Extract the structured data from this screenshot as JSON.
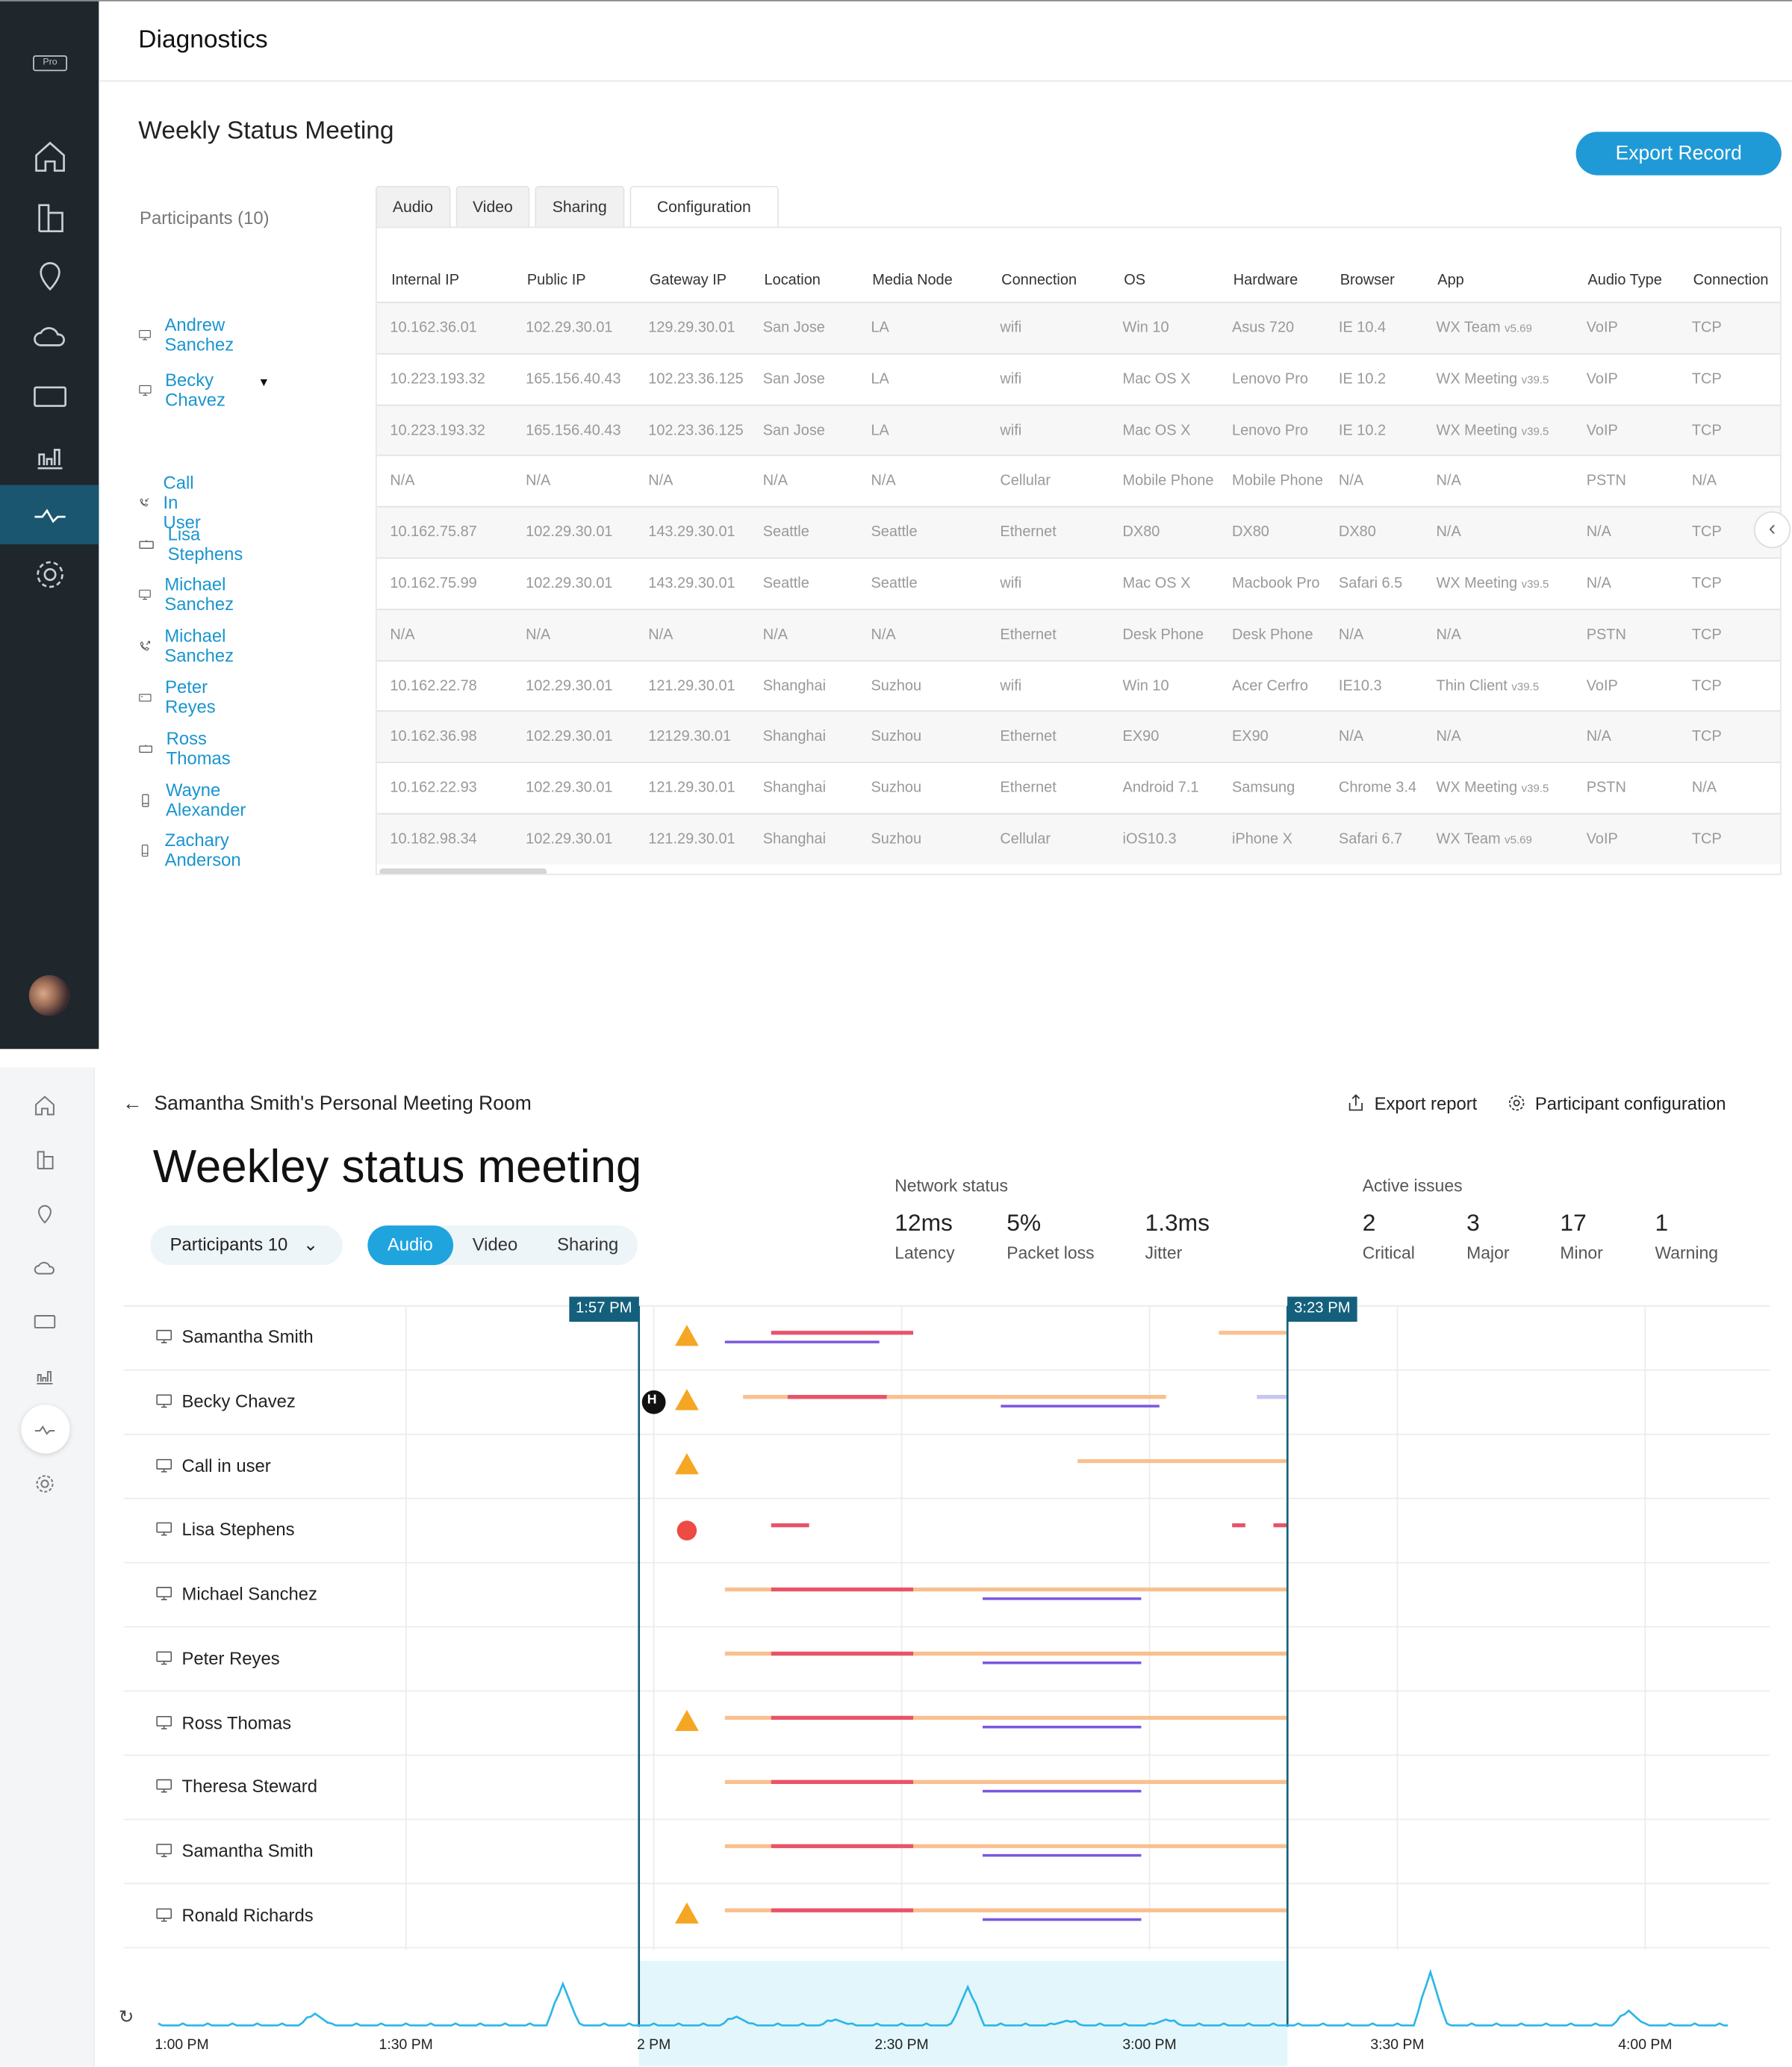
{
  "diagnostics": {
    "badge": "Pro",
    "header": "Diagnostics",
    "meeting_title": "Weekly Status Meeting",
    "export_label": "Export Record",
    "participants_label": "Participants (10)",
    "sidebar_icons": [
      "home-icon",
      "building-icon",
      "location-icon",
      "cloud-icon",
      "device-icon",
      "analytics-icon",
      "diagnostics-icon",
      "settings-icon"
    ],
    "participants": [
      {
        "name": "Andrew Sanchez",
        "device": "desktop"
      },
      {
        "name": "Becky Chavez",
        "device": "desktop",
        "expanded": true
      },
      {
        "name": "Call In User",
        "device": "phone-in"
      },
      {
        "name": "Lisa Stephens",
        "device": "room"
      },
      {
        "name": "Michael Sanchez",
        "device": "desktop"
      },
      {
        "name": "Michael Sanchez",
        "device": "phone-out"
      },
      {
        "name": "Peter Reyes",
        "device": "board"
      },
      {
        "name": "Ross Thomas",
        "device": "room"
      },
      {
        "name": "Wayne Alexander",
        "device": "mobile"
      },
      {
        "name": "Zachary Anderson",
        "device": "mobile"
      }
    ],
    "tabs": [
      "Audio",
      "Video",
      "Sharing",
      "Configuration"
    ],
    "active_tab": "Configuration",
    "columns": [
      "Internal IP",
      "Public IP",
      "Gateway IP",
      "Location",
      "Media Node",
      "Connection",
      "OS",
      "Hardware",
      "Browser",
      "App",
      "Audio Type",
      "Connection"
    ],
    "rows": [
      [
        "10.162.36.01",
        "102.29.30.01",
        "129.29.30.01",
        "San Jose",
        "LA",
        "wifi",
        "Win 10",
        "Asus 720",
        "IE 10.4",
        [
          "WX Team",
          "v5.69"
        ],
        "VoIP",
        "TCP"
      ],
      [
        "10.223.193.32",
        "165.156.40.43",
        "102.23.36.125",
        "San Jose",
        "LA",
        "wifi",
        "Mac OS X",
        "Lenovo Pro",
        "IE 10.2",
        [
          "WX Meeting",
          "v39.5"
        ],
        "VoIP",
        "TCP"
      ],
      [
        "10.223.193.32",
        "165.156.40.43",
        "102.23.36.125",
        "San Jose",
        "LA",
        "wifi",
        "Mac OS X",
        "Lenovo Pro",
        "IE 10.2",
        [
          "WX Meeting",
          "v39.5"
        ],
        "VoIP",
        "TCP"
      ],
      [
        "N/A",
        "N/A",
        "N/A",
        "N/A",
        "N/A",
        "Cellular",
        "Mobile Phone",
        "Mobile Phone",
        "N/A",
        [
          "N/A",
          ""
        ],
        "PSTN",
        "N/A"
      ],
      [
        "10.162.75.87",
        "102.29.30.01",
        "143.29.30.01",
        "Seattle",
        "Seattle",
        "Ethernet",
        "DX80",
        "DX80",
        "DX80",
        [
          "N/A",
          ""
        ],
        "N/A",
        "TCP"
      ],
      [
        "10.162.75.99",
        "102.29.30.01",
        "143.29.30.01",
        "Seattle",
        "Seattle",
        "wifi",
        "Mac OS X",
        "Macbook Pro",
        "Safari 6.5",
        [
          "WX Meeting",
          "v39.5"
        ],
        "N/A",
        "TCP"
      ],
      [
        "N/A",
        "N/A",
        "N/A",
        "N/A",
        "N/A",
        "Ethernet",
        "Desk Phone",
        "Desk Phone",
        "N/A",
        [
          "N/A",
          ""
        ],
        "PSTN",
        "TCP"
      ],
      [
        "10.162.22.78",
        "102.29.30.01",
        "121.29.30.01",
        "Shanghai",
        "Suzhou",
        "wifi",
        "Win 10",
        "Acer Cerfro",
        "IE10.3",
        [
          "Thin Client",
          "v39.5"
        ],
        "VoIP",
        "TCP"
      ],
      [
        "10.162.36.98",
        "102.29.30.01",
        "12129.30.01",
        "Shanghai",
        "Suzhou",
        "Ethernet",
        "EX90",
        "EX90",
        "N/A",
        [
          "N/A",
          ""
        ],
        "N/A",
        "TCP"
      ],
      [
        "10.162.22.93",
        "102.29.30.01",
        "121.29.30.01",
        "Shanghai",
        "Suzhou",
        "Ethernet",
        "Android 7.1",
        "Samsung",
        "Chrome 3.4",
        [
          "WX Meeting",
          "v39.5"
        ],
        "PSTN",
        "N/A"
      ],
      [
        "10.182.98.34",
        "102.29.30.01",
        "121.29.30.01",
        "Shanghai",
        "Suzhou",
        "Cellular",
        "iOS10.3",
        "iPhone X",
        "Safari 6.7",
        [
          "WX Team",
          "v5.69"
        ],
        "VoIP",
        "TCP"
      ]
    ]
  },
  "meeting": {
    "back_label": "←",
    "room": "Samantha Smith's Personal Meeting Room",
    "export_label": "Export report",
    "config_label": "Participant configuration",
    "title": "Weekley status meeting",
    "participants_filter": "Participants 10",
    "media_tabs": [
      "Audio",
      "Video",
      "Sharing"
    ],
    "active_media": "Audio",
    "network_status": {
      "label": "Network status",
      "metrics": [
        {
          "value": "12ms",
          "label": "Latency"
        },
        {
          "value": "5%",
          "label": "Packet loss"
        },
        {
          "value": "1.3ms",
          "label": "Jitter"
        }
      ]
    },
    "active_issues": {
      "label": "Active issues",
      "metrics": [
        {
          "value": "2",
          "label": "Critical"
        },
        {
          "value": "3",
          "label": "Major"
        },
        {
          "value": "17",
          "label": "Minor"
        },
        {
          "value": "1",
          "label": "Warning"
        }
      ]
    },
    "colors": {
      "orange": "#f9c08f",
      "red": "#e9536a",
      "purple": "#7b57e0",
      "lavender": "#c6c6ee",
      "warning": "#f5a623",
      "critical": "#ee4b45",
      "accent": "#1fa4de",
      "marker": "#14607c"
    }
  },
  "chart_data": {
    "type": "timeline",
    "x_unit": "minutes after 1:00 PM",
    "xlim": [
      0,
      190
    ],
    "ticks": [
      {
        "m": 0,
        "label": "1:00 PM"
      },
      {
        "m": 30,
        "label": "1:30 PM"
      },
      {
        "m": 60,
        "label": "2 PM"
      },
      {
        "m": 90,
        "label": "2:30 PM"
      },
      {
        "m": 120,
        "label": "3:00 PM"
      },
      {
        "m": 150,
        "label": "3:30 PM"
      },
      {
        "m": 180,
        "label": "4:00 PM"
      }
    ],
    "selection": {
      "start": {
        "m": 58.2,
        "label": "1:57 PM"
      },
      "end": {
        "m": 136.7,
        "label": "3:23 PM"
      }
    },
    "rows": [
      {
        "name": "Samantha Smith",
        "icon": "warning",
        "icon_m": 64,
        "bars": [
          [
            "red",
            74.2,
            91.4
          ],
          [
            "purple",
            68.6,
            87.3
          ],
          [
            "orange",
            128.4,
            136.7
          ]
        ]
      },
      {
        "name": "Becky  Chavez",
        "icon": "warning",
        "icon_m": 64,
        "hold_m": 60,
        "hold_label": "H",
        "bars": [
          [
            "orange",
            70.8,
            122
          ],
          [
            "red",
            76.2,
            88.2
          ],
          [
            "purple",
            102,
            121.2
          ],
          [
            "lavender",
            133,
            136.7
          ]
        ]
      },
      {
        "name": "Call in user",
        "icon": "warning",
        "icon_m": 64,
        "bars": [
          [
            "orange",
            111.3,
            136.7
          ]
        ]
      },
      {
        "name": "Lisa Stephens",
        "icon": "critical",
        "icon_m": 64,
        "bars": [
          [
            "red",
            74.2,
            78.8
          ],
          [
            "red",
            130,
            131.6
          ],
          [
            "red",
            135,
            136.7
          ]
        ]
      },
      {
        "name": "Michael Sanchez",
        "bars": [
          [
            "orange",
            68.6,
            136.7
          ],
          [
            "red",
            74.2,
            91.4
          ],
          [
            "purple",
            99.8,
            119
          ]
        ]
      },
      {
        "name": "Peter Reyes",
        "bars": [
          [
            "orange",
            68.6,
            136.7
          ],
          [
            "red",
            74.2,
            91.4
          ],
          [
            "purple",
            99.8,
            119
          ]
        ]
      },
      {
        "name": "Ross Thomas",
        "icon": "warning",
        "icon_m": 64,
        "bars": [
          [
            "orange",
            68.6,
            136.7
          ],
          [
            "red",
            74.2,
            91.4
          ],
          [
            "purple",
            99.8,
            119
          ]
        ]
      },
      {
        "name": "Theresa Steward",
        "bars": [
          [
            "orange",
            68.6,
            136.7
          ],
          [
            "red",
            74.2,
            91.4
          ],
          [
            "purple",
            99.8,
            119
          ]
        ]
      },
      {
        "name": "Samantha Smith",
        "bars": [
          [
            "orange",
            68.6,
            136.7
          ],
          [
            "red",
            74.2,
            91.4
          ],
          [
            "purple",
            99.8,
            119
          ]
        ]
      },
      {
        "name": "Ronald Richards",
        "icon": "warning",
        "icon_m": 64,
        "bars": [
          [
            "orange",
            68.6,
            136.7
          ],
          [
            "red",
            74.2,
            91.4
          ],
          [
            "purple",
            99.8,
            119
          ]
        ]
      }
    ],
    "activity_spikes": [
      [
        19,
        0.2
      ],
      [
        49,
        0.7
      ],
      [
        70,
        0.15
      ],
      [
        82,
        0.1
      ],
      [
        98,
        0.65
      ],
      [
        110,
        0.08
      ],
      [
        122,
        0.1
      ],
      [
        154,
        0.9
      ],
      [
        178,
        0.25
      ]
    ]
  }
}
